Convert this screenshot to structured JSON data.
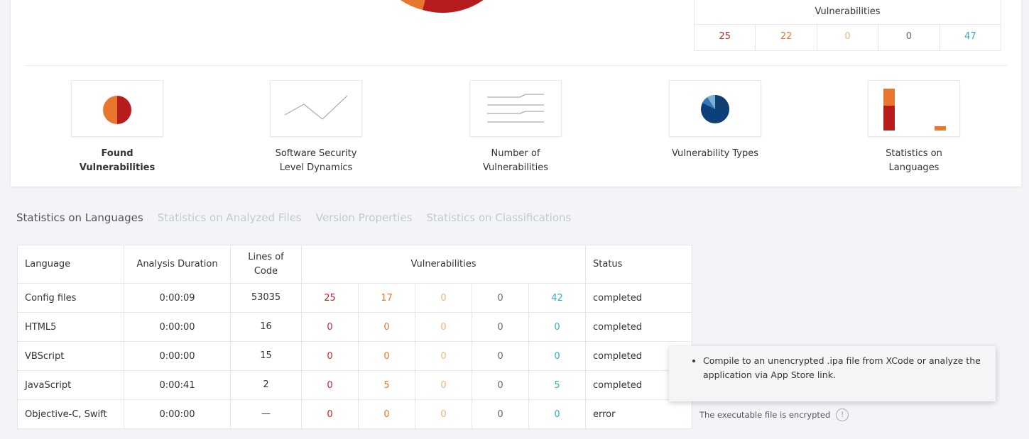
{
  "summary": {
    "header": "Vulnerabilities",
    "counts": [
      "25",
      "22",
      "0",
      "0",
      "47"
    ],
    "colors": [
      "#c62828",
      "#e8762c",
      "#f0b27a",
      "#666666",
      "#2eb0c0"
    ]
  },
  "tiles": [
    {
      "label_line1": "Found",
      "label_line2": "Vulnerabilities",
      "icon": "pie-chart-icon"
    },
    {
      "label_line1": "Software Security",
      "label_line2": "Level Dynamics",
      "icon": "line-chart-icon"
    },
    {
      "label_line1": "Number of",
      "label_line2": "Vulnerabilities",
      "icon": "stacked-lines-icon"
    },
    {
      "label_line1": "Vulnerability Types",
      "label_line2": "",
      "icon": "types-pie-icon"
    },
    {
      "label_line1": "Statistics on",
      "label_line2": "Languages",
      "icon": "bar-chart-icon"
    }
  ],
  "tabs": [
    {
      "label": "Statistics on Languages",
      "active": true
    },
    {
      "label": "Statistics on Analyzed Files",
      "active": false
    },
    {
      "label": "Version Properties",
      "active": false
    },
    {
      "label": "Statistics on Classifications",
      "active": false
    }
  ],
  "table": {
    "headers": {
      "language": "Language",
      "duration": "Analysis Duration",
      "loc_line1": "Lines of",
      "loc_line2": "Code",
      "vulns": "Vulnerabilities",
      "status": "Status"
    },
    "rows": [
      {
        "language": "Config files",
        "duration": "0:00:09",
        "loc": "53035",
        "v": [
          "25",
          "17",
          "0",
          "0",
          "42"
        ],
        "status": "completed"
      },
      {
        "language": "HTML5",
        "duration": "0:00:00",
        "loc": "16",
        "v": [
          "0",
          "0",
          "0",
          "0",
          "0"
        ],
        "status": "completed"
      },
      {
        "language": "VBScript",
        "duration": "0:00:00",
        "loc": "15",
        "v": [
          "0",
          "0",
          "0",
          "0",
          "0"
        ],
        "status": "completed"
      },
      {
        "language": "JavaScript",
        "duration": "0:00:41",
        "loc": "2",
        "v": [
          "0",
          "5",
          "0",
          "0",
          "5"
        ],
        "status": "completed"
      },
      {
        "language": "Objective-C, Swift",
        "duration": "0:00:00",
        "loc": "—",
        "v": [
          "0",
          "0",
          "0",
          "0",
          "0"
        ],
        "status": "error"
      }
    ]
  },
  "tooltip": {
    "text": "Compile to an unencrypted .ipa file from XCode or analyze the application via App Store link."
  },
  "note": {
    "text": "The executable file is encrypted",
    "icon": "info-icon"
  }
}
